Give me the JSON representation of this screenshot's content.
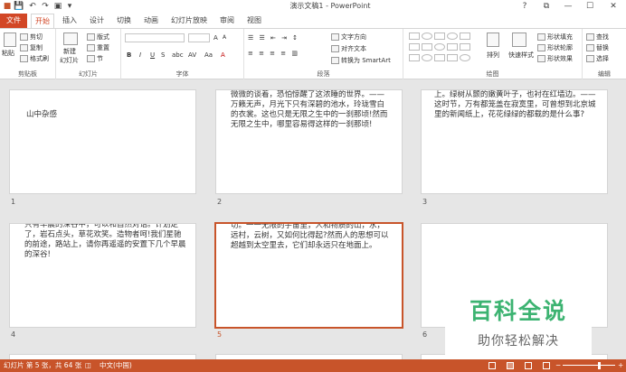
{
  "window": {
    "title": "演示文稿1 - PowerPoint",
    "controls": {
      "help": "?",
      "ribbon_toggle": "⧉",
      "minimize": "—",
      "maximize": "☐",
      "close": "✕"
    }
  },
  "quick_access": {
    "save": "💾",
    "undo": "↶",
    "redo": "↷",
    "present": "▣",
    "customize": "▾"
  },
  "tabs": [
    {
      "label": "文件"
    },
    {
      "label": "开始"
    },
    {
      "label": "插入"
    },
    {
      "label": "设计"
    },
    {
      "label": "切换"
    },
    {
      "label": "动画"
    },
    {
      "label": "幻灯片放映"
    },
    {
      "label": "审阅"
    },
    {
      "label": "视图"
    }
  ],
  "colors": {
    "accent": "#d24726",
    "status_bar": "#c8542a",
    "selection": "#c8542a",
    "watermark_green": "#3cb371"
  },
  "ribbon": {
    "clipboard": {
      "label": "剪贴板",
      "paste": "粘贴",
      "cut": "剪切",
      "copy": "复制",
      "format_painter": "格式刷"
    },
    "slides": {
      "label": "幻灯片",
      "new_slide": "新建",
      "new_slide2": "幻灯片",
      "layout": "版式",
      "reset": "重置",
      "section": "节"
    },
    "font": {
      "label": "字体",
      "bold": "B",
      "italic": "I",
      "underline": "U",
      "strike": "S",
      "shadow": "abc",
      "spacing": "AV",
      "case": "Aa",
      "font_color": "A",
      "grow": "A",
      "shrink": "A"
    },
    "paragraph": {
      "label": "段落",
      "text_direction": "文字方向",
      "align_text": "对齐文本",
      "smartart": "转换为 SmartArt"
    },
    "drawing": {
      "label": "绘图",
      "arrange": "排列",
      "quick_styles": "快速样式",
      "shape_fill": "形状填充",
      "shape_outline": "形状轮廓",
      "shape_effects": "形状效果"
    },
    "editing": {
      "label": "编辑",
      "find": "查找",
      "replace": "替换",
      "select": "选择"
    }
  },
  "slides": [
    {
      "number": "1",
      "text": "山中杂感"
    },
    {
      "number": "2",
      "text": "微微的谈着，恐怕惊醒了这浓睡的世界。——万籁无声，月光下只有深碧的池水，玲珑雪白的衣裳。这也只是无限之生中的一刹那顷!然而无限之生中，哪里容易得这样的一刹那顷!"
    },
    {
      "number": "3",
      "text": "上。绿树从颤的嫩黄叶子，也衬在红墙边。——这时节，万有都笼盖在寂寞里，可曾想到北京城里的新闻纸上，花花绿绿的都载的是什么事?"
    },
    {
      "number": "4",
      "text": "只有早晨的深谷中，可以和自然对话。计划定了，岩石点头，草花欢笑。造物者呵!我们星驰的前途，路站上，请你再遥遥的安置下几个早晨的深谷!"
    },
    {
      "number": "5",
      "text": "切。一一无限的宇宙里，人和物质的山，水，远村，云树，又如何比得起?然而人的思想可以超越到太空里去，它们却永远只在地面上。"
    },
    {
      "number": "6",
      "text": ""
    }
  ],
  "watermark": {
    "title": "百科全说",
    "subtitle": "助你轻松解决"
  },
  "status": {
    "slide_info": "幻灯片 第 5 张，共 64 张",
    "language": "中文(中国)"
  }
}
